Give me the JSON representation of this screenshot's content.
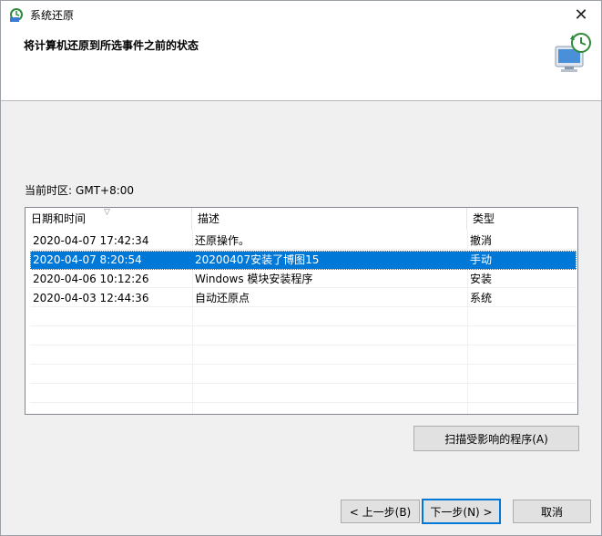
{
  "window": {
    "title": "系统还原",
    "close_glyph": "✕",
    "icon": "system-restore-icon"
  },
  "header": {
    "heading": "将计算机还原到所选事件之前的状态",
    "art_icon": "monitor-restore-clock-icon"
  },
  "timezone": {
    "label": "当前时区:",
    "value": "GMT+8:00"
  },
  "table": {
    "columns": [
      "日期和时间",
      "描述",
      "类型"
    ],
    "sorted_column": "日期和时间",
    "rows": [
      {
        "date": "2020-04-07 17:42:34",
        "description": "还原操作。",
        "type": "撤消",
        "selected": false
      },
      {
        "date": "2020-04-07 8:20:54",
        "description": "20200407安装了博图15",
        "type": "手动",
        "selected": true
      },
      {
        "date": "2020-04-06 10:12:26",
        "description": "Windows 模块安装程序",
        "type": "安装",
        "selected": false
      },
      {
        "date": "2020-04-03 12:44:36",
        "description": "自动还原点",
        "type": "系统",
        "selected": false
      }
    ]
  },
  "buttons": {
    "scan": "扫描受影响的程序(A)",
    "back": "< 上一步(B)",
    "next": "下一步(N) >",
    "cancel": "取消"
  },
  "colors": {
    "selection": "#0078d7",
    "dialog_bg": "#f0f0f0",
    "header_bg": "#ffffff"
  }
}
